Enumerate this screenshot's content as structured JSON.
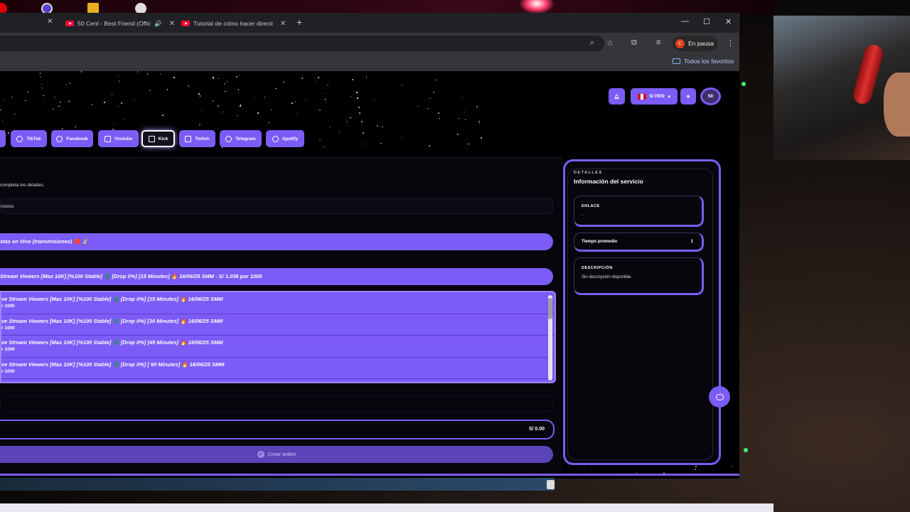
{
  "browser": {
    "tabs": [
      {
        "label": "50 Cent - Best Friend (Offic",
        "has_audio": true
      },
      {
        "label": "Tutorial de cómo hacer directo",
        "has_audio": false
      }
    ],
    "profile_status": "En pausa",
    "profile_initial": "C",
    "bookmarks_all": "Todos los favoritos"
  },
  "header": {
    "currency": "S/ PEN",
    "avatar": "50"
  },
  "platforms": [
    {
      "label": "TikTok",
      "icon": "tiktok-icon"
    },
    {
      "label": "Facebook",
      "icon": "facebook-icon"
    },
    {
      "label": "Youtube",
      "icon": "youtube-icon"
    },
    {
      "label": "Kick",
      "icon": "kick-icon",
      "active": true
    },
    {
      "label": "Twitch",
      "icon": "twitch-icon"
    },
    {
      "label": "Telegram",
      "icon": "telegram-icon"
    },
    {
      "label": "Spotify",
      "icon": "spotify-icon"
    }
  ],
  "form": {
    "subtitle": "completa los detalles.",
    "category_label": "rvicios",
    "category_selected": "stas en Vivo (transmisiones) 🔴 ⏳",
    "service_selected": "Stream Viewers [Max 10K] [%100 Stable] 💲 [Drop 0%] [15 Minutes] 🔥 16/06/25 SMM - S/ 1.036 por 1000",
    "options": [
      {
        "title": "ve Stream Viewers [Max 10K] [%100 Stable] 💲 [Drop 0%] [15 Minutes] 🔥 16/06/25 SMM",
        "sub": "r 1000"
      },
      {
        "title": "ve Stream Viewers [Max 10K] [%100 Stable] 💲 [Drop 0%] [30 Minutes] 🔥 16/06/25 SMM",
        "sub": "r 1000"
      },
      {
        "title": "ve Stream Viewers [Max 10K] [%100 Stable] 💲 [Drop 0%] [45 Minutes] 🔥 16/06/25 SMM",
        "sub": "r 1000"
      },
      {
        "title": "ve Stream Viewers [Max 10K] [%100 Stable] 💲 [Drop 0%] [ 60 Minutes] 🔥 16/06/25 SMM",
        "sub": "r 1000"
      }
    ],
    "total": "S/ 0.00",
    "submit": "Crear orden"
  },
  "details": {
    "kicker": "DETALLES",
    "title": "Información del servicio",
    "link_label": "ENLACE",
    "link_value": "-",
    "time_label": "Tiempo promedio",
    "time_value": "1",
    "desc_label": "DESCRIPCIÓN",
    "desc_value": "Sin descripción disponible."
  },
  "colors": {
    "accent": "#7c5cf6",
    "background": "#000000",
    "panel": "#07060c"
  }
}
